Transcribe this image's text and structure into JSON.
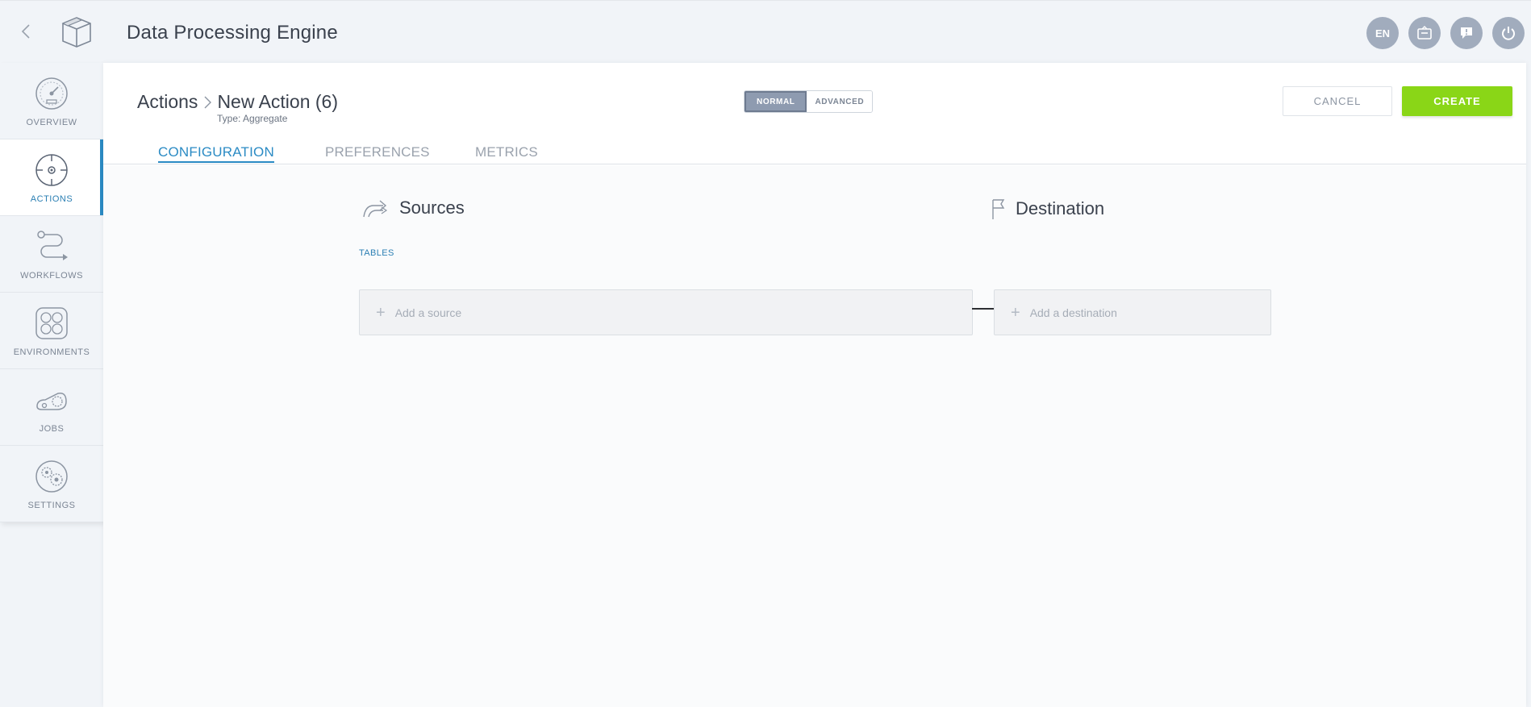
{
  "app": {
    "title": "Data Processing Engine",
    "top_icons": [
      {
        "name": "language-button",
        "label": "EN"
      },
      {
        "name": "news-icon"
      },
      {
        "name": "feedback-icon"
      },
      {
        "name": "power-icon"
      }
    ]
  },
  "sidebar": {
    "items": [
      {
        "label": "OVERVIEW",
        "icon": "speedometer-icon",
        "active": false
      },
      {
        "label": "ACTIONS",
        "icon": "target-icon",
        "active": true
      },
      {
        "label": "WORKFLOWS",
        "icon": "workflow-icon",
        "active": false
      },
      {
        "label": "ENVIRONMENTS",
        "icon": "network-icon",
        "active": false
      },
      {
        "label": "JOBS",
        "icon": "jobs-icon",
        "active": false
      },
      {
        "label": "SETTINGS",
        "icon": "gears-icon",
        "active": false
      }
    ]
  },
  "header": {
    "breadcrumb_root": "Actions",
    "breadcrumb_current": "New Action (6)",
    "subtype": "Type: Aggregate",
    "mode_normal": "NORMAL",
    "mode_advanced": "ADVANCED",
    "cancel_label": "CANCEL",
    "create_label": "CREATE"
  },
  "tabs": [
    {
      "label": "CONFIGURATION",
      "active": true
    },
    {
      "label": "PREFERENCES",
      "active": false
    },
    {
      "label": "METRICS",
      "active": false
    }
  ],
  "config": {
    "sources_title": "Sources",
    "destination_title": "Destination",
    "tables_label": "TABLES",
    "add_source": "Add a source",
    "add_destination": "Add a destination"
  },
  "colors": {
    "accent": "#2b8bc4",
    "create_button": "#8ad617",
    "mode_active": "#8e9bb0",
    "header_icons": "#a1acbd"
  }
}
